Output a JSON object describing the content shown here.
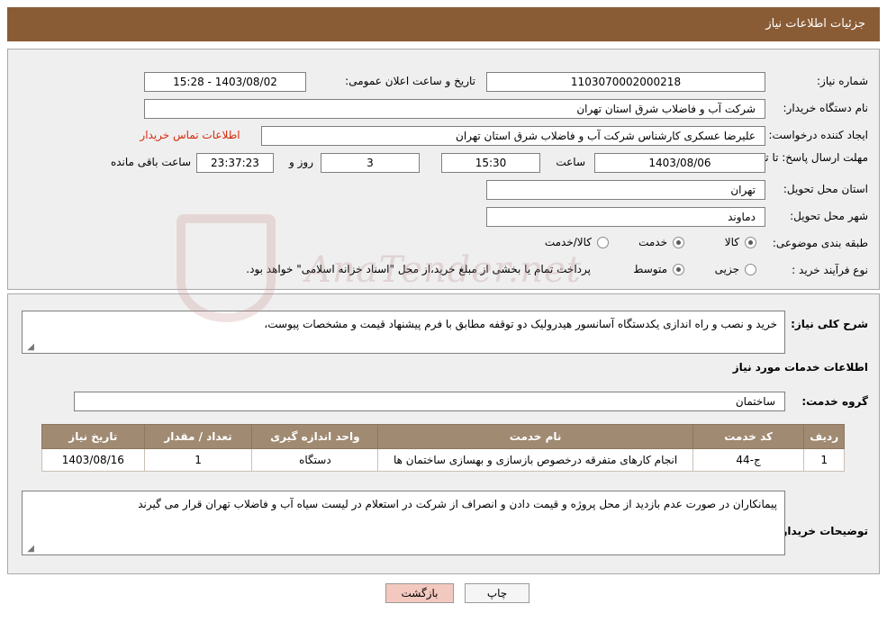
{
  "header": {
    "title": "جزئیات اطلاعات نیاز"
  },
  "top": {
    "need_number_label": "شماره نیاز:",
    "need_number_value": "1103070002000218",
    "announce_datetime_label": "تاریخ و ساعت اعلان عمومی:",
    "announce_datetime_value": "1403/08/02 - 15:28",
    "buyer_org_label": "نام دستگاه خریدار:",
    "buyer_org_value": "شرکت آب و فاضلاب شرق استان تهران",
    "requester_label": "ایجاد کننده درخواست:",
    "requester_value": "علیرضا عسکری کارشناس شرکت آب و فاضلاب شرق استان تهران",
    "contact_link": "اطلاعات تماس خریدار",
    "deadline_label": "مهلت ارسال پاسخ: تا تاریخ:",
    "deadline_date": "1403/08/06",
    "deadline_hour_label": "ساعت",
    "deadline_hour": "15:30",
    "days_value": "3",
    "days_label": "روز و",
    "remaining_value": "23:37:23",
    "remaining_label": "ساعت باقی مانده",
    "province_label": "استان محل تحویل:",
    "province_value": "تهران",
    "city_label": "شهر محل تحویل:",
    "city_value": "دماوند",
    "category_label": "طبقه بندی موضوعی:",
    "category_options": [
      {
        "label": "کالا",
        "checked": false
      },
      {
        "label": "خدمت",
        "checked": true
      },
      {
        "label": "کالا/خدمت",
        "checked": false
      }
    ],
    "process_label": "نوع فرآیند خرید :",
    "process_options": [
      {
        "label": "جزیی",
        "checked": false
      },
      {
        "label": "متوسط",
        "checked": true
      }
    ],
    "process_note": "پرداخت تمام یا بخشی از مبلغ خرید،از محل \"اسناد خزانه اسلامی\" خواهد بود."
  },
  "bottom": {
    "summary_label": "شرح کلی نیاز:",
    "summary_value": "خرید و نصب و راه اندازی یکدستگاه آسانسور هیدرولیک دو توقفه مطابق با فرم پیشنهاد قیمت و مشخصات پیوست،",
    "services_info_heading": "اطلاعات خدمات مورد نیاز",
    "service_group_label": "گروه خدمت:",
    "service_group_value": "ساختمان",
    "table": {
      "columns": [
        "ردیف",
        "کد خدمت",
        "نام خدمت",
        "واحد اندازه گیری",
        "تعداد / مقدار",
        "تاریخ نیاز"
      ],
      "rows": [
        {
          "row": "1",
          "code": "ج-44",
          "name": "انجام کارهای متفرقه درخصوص بازسازی و بهسازی ساختمان ها",
          "unit": "دستگاه",
          "qty": "1",
          "date": "1403/08/16"
        }
      ]
    },
    "buyer_notes_label": "توضیحات خریدار:",
    "buyer_notes_value": "پیمانکاران در صورت عدم بازدید از محل پروژه و قیمت دادن و انصراف از شرکت در استعلام در لیست سیاه آب و فاضلاب تهران قرار می گیرند"
  },
  "footer": {
    "print_label": "چاپ",
    "back_label": "بازگشت"
  },
  "watermark": {
    "text": "AnaTender.net"
  },
  "colors": {
    "header_bg": "#8a5c36",
    "panel_bg": "#f0efef",
    "link": "#d6290c",
    "table_header_bg": "#a08a72",
    "back_button_bg": "#f3c9bf"
  }
}
